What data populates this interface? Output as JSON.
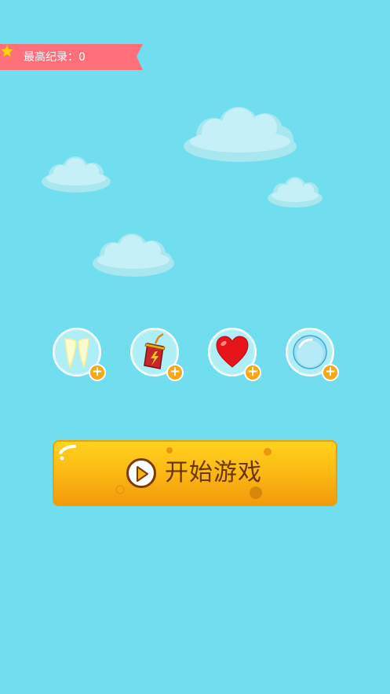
{
  "highscore": {
    "label": "最高纪录：",
    "value": "0"
  },
  "powerups": [
    {
      "name": "fangs",
      "icon": "fangs-icon",
      "badge": "+"
    },
    {
      "name": "energy-drink",
      "icon": "energy-drink-icon",
      "badge": "+"
    },
    {
      "name": "heart",
      "icon": "heart-icon",
      "badge": "+"
    },
    {
      "name": "bubble",
      "icon": "bubble-shield-icon",
      "badge": "+"
    }
  ],
  "start_button": {
    "label": "开始游戏",
    "icon": "play-icon"
  },
  "colors": {
    "sky": "#70deef",
    "ribbon": "#fd6f7b",
    "button": "#fbbb14",
    "button_text": "#6b3400"
  }
}
